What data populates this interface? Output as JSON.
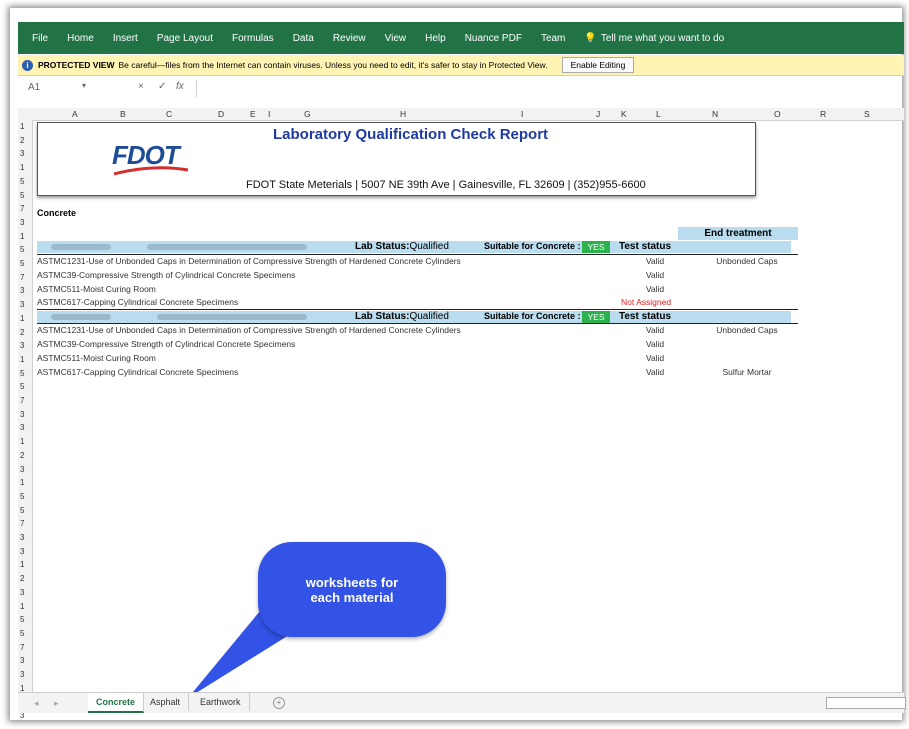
{
  "ribbon": {
    "tabs": [
      "File",
      "Home",
      "Insert",
      "Page Layout",
      "Formulas",
      "Data",
      "Review",
      "View",
      "Help",
      "Nuance PDF",
      "Team"
    ],
    "tell_me": "Tell me what you want to do"
  },
  "protected_view": {
    "label": "PROTECTED VIEW",
    "message": "Be careful—files from the Internet can contain viruses. Unless you need to edit, it's safer to stay in Protected View.",
    "button": "Enable Editing"
  },
  "formula_bar": {
    "name_box": "A1",
    "cancel": "×",
    "enter": "✓",
    "fx": "fx"
  },
  "columns": [
    "A",
    "B",
    "C",
    "D",
    "E",
    "I",
    "G",
    "H",
    "I",
    "J",
    "K",
    "L",
    "N",
    "O",
    "R",
    "S"
  ],
  "rows": [
    "1",
    "2",
    "3",
    "1",
    "5",
    "5",
    "7",
    "3",
    "1",
    "5",
    "5",
    "7",
    "3",
    "3",
    "1",
    "2",
    "3",
    "1",
    "5",
    "5",
    "7",
    "3",
    "3",
    "1",
    "2",
    "3",
    "1",
    "5",
    "5",
    "7",
    "3",
    "3",
    "1",
    "2",
    "3",
    "1",
    "5",
    "5",
    "7",
    "3",
    "3",
    "1",
    "2",
    "3"
  ],
  "report": {
    "logo_text": "FDOT",
    "title": "Laboratory Qualification Check Report",
    "address": "FDOT State Meterials | 5007 NE 39th Ave | Gainesville, FL 32609 | (352)955-6600"
  },
  "sheet_title": "Concrete",
  "end_treatment_header": "End treatment",
  "labs": [
    {
      "status_label": "Lab Status:",
      "status_value": "Qualified",
      "suitable_label": "Suitable for Concrete :",
      "suitable_value": "YES",
      "test_status_header": "Test status",
      "tests": [
        {
          "name": "ASTMC1231-Use of Unbonded Caps in Determination of Compressive Strength of Hardened Concrete Cylinders",
          "status": "Valid",
          "end": "Unbonded Caps"
        },
        {
          "name": "ASTMC39-Compressive Strength of Cylindrical Concrete Specimens",
          "status": "Valid",
          "end": ""
        },
        {
          "name": "ASTMC511-Moist Curing Room",
          "status": "Valid",
          "end": ""
        },
        {
          "name": "ASTMC617-Capping Cylindrical Concrete Specimens",
          "status": "Not Assigned",
          "end": ""
        }
      ]
    },
    {
      "status_label": "Lab Status:",
      "status_value": "Qualified",
      "suitable_label": "Suitable for Concrete :",
      "suitable_value": "YES",
      "test_status_header": "Test status",
      "tests": [
        {
          "name": "ASTMC1231-Use of Unbonded Caps in Determination of Compressive Strength of Hardened Concrete Cylinders",
          "status": "Valid",
          "end": "Unbonded Caps"
        },
        {
          "name": "ASTMC39-Compressive Strength of Cylindrical Concrete Specimens",
          "status": "Valid",
          "end": ""
        },
        {
          "name": "ASTMC511-Moist Curing Room",
          "status": "Valid",
          "end": ""
        },
        {
          "name": "ASTMC617-Capping Cylindrical Concrete Specimens",
          "status": "Valid",
          "end": "Sulfur Mortar"
        }
      ]
    }
  ],
  "sheet_tabs": [
    "Concrete",
    "Asphalt",
    "Earthwork"
  ],
  "callout": {
    "line1": "worksheets for",
    "line2": "each material"
  },
  "colors": {
    "excel_green": "#217346",
    "band_blue": "#b9dcef",
    "yes_green": "#2bb24c",
    "callout_blue": "#3352e6",
    "invalid_red": "#e02020"
  },
  "icons": [
    "info-icon",
    "bulb-icon",
    "dropdown-arrow-icon",
    "add-sheet-icon",
    "scroll-left-icon",
    "scroll-right-icon"
  ]
}
